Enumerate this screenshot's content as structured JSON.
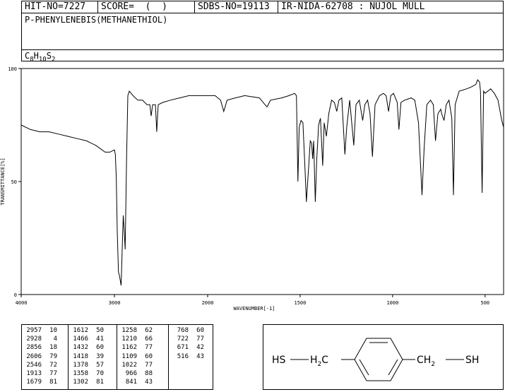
{
  "header": {
    "hit_no": "HIT-NO=7227",
    "score": "SCORE=  (  )",
    "sdbs_no": "SDBS-NO=19113",
    "ir_id": "IR-NIDA-62708 : NUJOL MULL",
    "compound_name": "P-PHENYLENEBIS(METHANETHIOL)",
    "formula": {
      "c": "C",
      "c_n": "8",
      "h": "H",
      "h_n": "10",
      "s": "S",
      "s_n": "2"
    }
  },
  "chart_data": {
    "type": "line",
    "xlabel": "WAVENUMBER[-1]",
    "ylabel": "TRANSMITTANCE[%]",
    "xlim": [
      4000,
      400
    ],
    "ylim": [
      0,
      100
    ],
    "x_ticks": [
      4000,
      3000,
      2000,
      1500,
      1000,
      500
    ],
    "y_ticks": [
      100,
      50,
      0
    ],
    "series": [
      {
        "points": [
          [
            4000,
            75
          ],
          [
            3900,
            73
          ],
          [
            3800,
            72
          ],
          [
            3700,
            72
          ],
          [
            3600,
            71
          ],
          [
            3500,
            70
          ],
          [
            3400,
            69
          ],
          [
            3300,
            68
          ],
          [
            3200,
            66
          ],
          [
            3100,
            63
          ],
          [
            3050,
            63
          ],
          [
            3000,
            64
          ],
          [
            2990,
            62
          ],
          [
            2980,
            52
          ],
          [
            2970,
            28
          ],
          [
            2957,
            10
          ],
          [
            2945,
            8
          ],
          [
            2928,
            4
          ],
          [
            2915,
            22
          ],
          [
            2905,
            35
          ],
          [
            2895,
            28
          ],
          [
            2885,
            20
          ],
          [
            2870,
            60
          ],
          [
            2856,
            88
          ],
          [
            2840,
            90
          ],
          [
            2800,
            88
          ],
          [
            2750,
            86
          ],
          [
            2700,
            86
          ],
          [
            2650,
            84
          ],
          [
            2620,
            84
          ],
          [
            2606,
            79
          ],
          [
            2590,
            84
          ],
          [
            2560,
            84
          ],
          [
            2546,
            72
          ],
          [
            2530,
            84
          ],
          [
            2480,
            85
          ],
          [
            2400,
            86
          ],
          [
            2300,
            87
          ],
          [
            2200,
            88
          ],
          [
            2100,
            88
          ],
          [
            2000,
            88
          ],
          [
            1960,
            88
          ],
          [
            1930,
            86
          ],
          [
            1913,
            81
          ],
          [
            1895,
            86
          ],
          [
            1850,
            87
          ],
          [
            1800,
            88
          ],
          [
            1720,
            87
          ],
          [
            1690,
            84
          ],
          [
            1679,
            83
          ],
          [
            1660,
            86
          ],
          [
            1600,
            87
          ],
          [
            1560,
            88
          ],
          [
            1530,
            89
          ],
          [
            1520,
            88
          ],
          [
            1512,
            50
          ],
          [
            1505,
            74
          ],
          [
            1495,
            77
          ],
          [
            1485,
            76
          ],
          [
            1475,
            58
          ],
          [
            1466,
            41
          ],
          [
            1455,
            55
          ],
          [
            1445,
            68
          ],
          [
            1438,
            67
          ],
          [
            1432,
            60
          ],
          [
            1427,
            68
          ],
          [
            1418,
            41
          ],
          [
            1410,
            60
          ],
          [
            1400,
            75
          ],
          [
            1390,
            78
          ],
          [
            1378,
            57
          ],
          [
            1370,
            76
          ],
          [
            1358,
            70
          ],
          [
            1345,
            80
          ],
          [
            1330,
            86
          ],
          [
            1315,
            85
          ],
          [
            1302,
            81
          ],
          [
            1290,
            86
          ],
          [
            1275,
            87
          ],
          [
            1258,
            62
          ],
          [
            1248,
            74
          ],
          [
            1232,
            86
          ],
          [
            1210,
            66
          ],
          [
            1198,
            84
          ],
          [
            1180,
            86
          ],
          [
            1162,
            77
          ],
          [
            1150,
            84
          ],
          [
            1135,
            86
          ],
          [
            1122,
            80
          ],
          [
            1109,
            61
          ],
          [
            1095,
            84
          ],
          [
            1070,
            88
          ],
          [
            1050,
            89
          ],
          [
            1035,
            88
          ],
          [
            1022,
            81
          ],
          [
            1010,
            88
          ],
          [
            995,
            89
          ],
          [
            975,
            85
          ],
          [
            966,
            73
          ],
          [
            955,
            85
          ],
          [
            935,
            86
          ],
          [
            900,
            87
          ],
          [
            880,
            86
          ],
          [
            860,
            76
          ],
          [
            841,
            44
          ],
          [
            830,
            64
          ],
          [
            815,
            84
          ],
          [
            795,
            86
          ],
          [
            780,
            84
          ],
          [
            768,
            68
          ],
          [
            755,
            80
          ],
          [
            740,
            82
          ],
          [
            735,
            80
          ],
          [
            722,
            77
          ],
          [
            710,
            84
          ],
          [
            695,
            86
          ],
          [
            680,
            78
          ],
          [
            671,
            44
          ],
          [
            662,
            84
          ],
          [
            640,
            90
          ],
          [
            600,
            91
          ],
          [
            570,
            92
          ],
          [
            550,
            93
          ],
          [
            540,
            95
          ],
          [
            530,
            94
          ],
          [
            525,
            90
          ],
          [
            516,
            45
          ],
          [
            508,
            90
          ],
          [
            500,
            89
          ],
          [
            470,
            91
          ],
          [
            450,
            89
          ],
          [
            430,
            86
          ],
          [
            410,
            77
          ],
          [
            400,
            74
          ]
        ]
      }
    ]
  },
  "peak_table": [
    {
      "wn": "2957",
      "t": "10"
    },
    {
      "wn": "2928",
      "t": "4"
    },
    {
      "wn": "2856",
      "t": "18"
    },
    {
      "wn": "2606",
      "t": "79"
    },
    {
      "wn": "2546",
      "t": "72"
    },
    {
      "wn": "1913",
      "t": "77"
    },
    {
      "wn": "1679",
      "t": "81"
    },
    {
      "wn": "1612",
      "t": "50"
    },
    {
      "wn": "1466",
      "t": "41"
    },
    {
      "wn": "1432",
      "t": "60"
    },
    {
      "wn": "1418",
      "t": "39"
    },
    {
      "wn": "1378",
      "t": "57"
    },
    {
      "wn": "1358",
      "t": "70"
    },
    {
      "wn": "1302",
      "t": "81"
    },
    {
      "wn": "1258",
      "t": "62"
    },
    {
      "wn": "1210",
      "t": "66"
    },
    {
      "wn": "1162",
      "t": "77"
    },
    {
      "wn": "1109",
      "t": "60"
    },
    {
      "wn": "1022",
      "t": "77"
    },
    {
      "wn": "966",
      "t": "88"
    },
    {
      "wn": "841",
      "t": "43"
    },
    {
      "wn": "768",
      "t": "60"
    },
    {
      "wn": "722",
      "t": "77"
    },
    {
      "wn": "671",
      "t": "42"
    },
    {
      "wn": "516",
      "t": "43"
    }
  ],
  "structure": {
    "left_sh": "HS",
    "left_h": "H",
    "left_h_sub": "2",
    "left_c": "C",
    "right_ch": "CH",
    "right_sub": "2",
    "right_sh": "SH"
  }
}
